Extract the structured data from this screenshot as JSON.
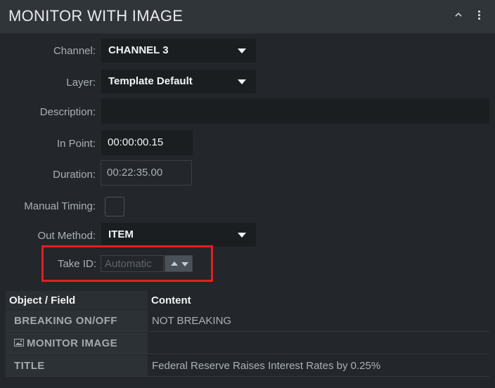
{
  "panel": {
    "title": "MONITOR WITH IMAGE",
    "collapse_icon": "chevron-up-icon",
    "menu_icon": "vertical-ellipsis-icon"
  },
  "form": {
    "channel": {
      "label": "Channel:",
      "value": "CHANNEL 3"
    },
    "layer": {
      "label": "Layer:",
      "value": "Template Default"
    },
    "description": {
      "label": "Description:",
      "value": ""
    },
    "in_point": {
      "label": "In Point:",
      "value": "00:00:00.15"
    },
    "duration": {
      "label": "Duration:",
      "value": "00:22:35.00"
    },
    "manual_timing": {
      "label": "Manual Timing:",
      "checked": false
    },
    "out_method": {
      "label": "Out Method:",
      "value": "ITEM"
    },
    "take_id": {
      "label": "Take ID:",
      "placeholder": "Automatic"
    }
  },
  "table": {
    "headers": [
      "Object / Field",
      "Content"
    ],
    "rows": [
      {
        "field": "BREAKING ON/OFF",
        "content": "NOT BREAKING",
        "icon": ""
      },
      {
        "field": "MONITOR IMAGE",
        "content": "",
        "icon": "image-icon"
      },
      {
        "field": "TITLE",
        "content": "Federal Reserve Raises Interest Rates by 0.25%",
        "icon": ""
      }
    ]
  },
  "colors": {
    "background": "#23272b",
    "titlebar": "#30353a",
    "input": "#1b1e21",
    "highlight": "#e0201f"
  }
}
